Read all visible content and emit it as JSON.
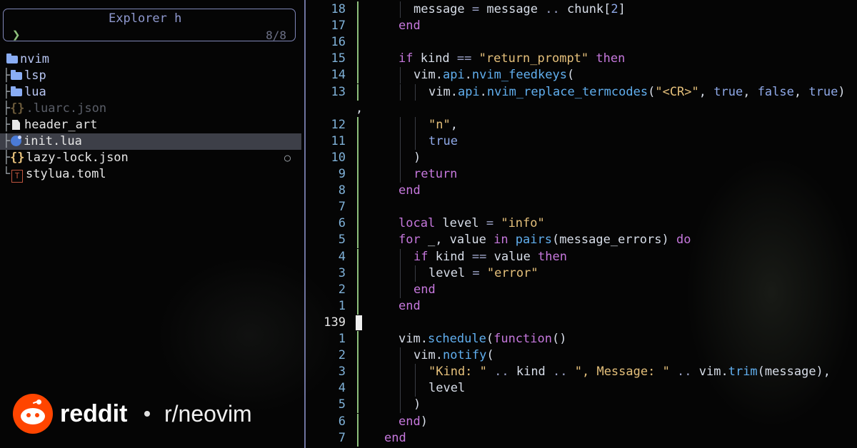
{
  "explorer": {
    "title": "Explorer  h",
    "prompt": "❯",
    "count": "8/8",
    "tree": [
      {
        "guide": "",
        "kind": "open-folder",
        "name": "nvim"
      },
      {
        "guide": "├",
        "kind": "folder",
        "name": "lsp"
      },
      {
        "guide": "├",
        "kind": "folder",
        "name": "lua"
      },
      {
        "guide": "├",
        "kind": "json-dim",
        "icon": "{}",
        "name": ".luarc.json"
      },
      {
        "guide": "├",
        "kind": "file",
        "name": "header_art"
      },
      {
        "guide": "├",
        "kind": "lua",
        "name": "init.lua",
        "selected": true
      },
      {
        "guide": "├",
        "kind": "json",
        "icon": "{}",
        "name": "lazy-lock.json",
        "marker": "○"
      },
      {
        "guide": "└",
        "kind": "toml",
        "icon": "T",
        "name": "stylua.toml"
      }
    ]
  },
  "editor": {
    "cursor_line": "139",
    "lines": [
      {
        "n": "18",
        "indent": 1,
        "tokens": [
          [
            "p",
            "message "
          ],
          [
            "o",
            "= "
          ],
          [
            "p",
            "message "
          ],
          [
            "o",
            ".. "
          ],
          [
            "p",
            "chunk["
          ],
          [
            "b",
            "2"
          ],
          [
            "p",
            "]"
          ]
        ]
      },
      {
        "n": "17",
        "indent": 0,
        "tokens": [
          [
            "k",
            "end"
          ]
        ]
      },
      {
        "n": "16",
        "indent": 0,
        "tokens": []
      },
      {
        "n": "15",
        "indent": 0,
        "tokens": [
          [
            "k",
            "if "
          ],
          [
            "p",
            "kind "
          ],
          [
            "o",
            "== "
          ],
          [
            "s",
            "\"return_prompt\" "
          ],
          [
            "k",
            "then"
          ]
        ]
      },
      {
        "n": "14",
        "indent": 1,
        "tokens": [
          [
            "p",
            "vim."
          ],
          [
            "f",
            "api"
          ],
          [
            "p",
            "."
          ],
          [
            "f",
            "nvim_feedkeys"
          ],
          [
            "p",
            "("
          ]
        ]
      },
      {
        "n": "13",
        "indent": 2,
        "tokens": [
          [
            "p",
            "vim."
          ],
          [
            "f",
            "api"
          ],
          [
            "p",
            "."
          ],
          [
            "f",
            "nvim_replace_termcodes"
          ],
          [
            "p",
            "("
          ],
          [
            "s",
            "\"<CR>\""
          ],
          [
            "p",
            ", "
          ],
          [
            "b",
            "true"
          ],
          [
            "p",
            ", "
          ],
          [
            "b",
            "false"
          ],
          [
            "p",
            ", "
          ],
          [
            "b",
            "true"
          ],
          [
            "p",
            ")"
          ]
        ]
      },
      {
        "n": "",
        "indent": -1,
        "tokens": [
          [
            "p",
            ","
          ]
        ]
      },
      {
        "n": "12",
        "indent": 2,
        "tokens": [
          [
            "s",
            "\"n\""
          ],
          [
            "p",
            ","
          ]
        ]
      },
      {
        "n": "11",
        "indent": 2,
        "tokens": [
          [
            "b",
            "true"
          ]
        ]
      },
      {
        "n": "10",
        "indent": 1,
        "tokens": [
          [
            "p",
            ")"
          ]
        ]
      },
      {
        "n": "9",
        "indent": 1,
        "tokens": [
          [
            "k",
            "return"
          ]
        ]
      },
      {
        "n": "8",
        "indent": 0,
        "tokens": [
          [
            "k",
            "end"
          ]
        ]
      },
      {
        "n": "7",
        "indent": 0,
        "tokens": []
      },
      {
        "n": "6",
        "indent": 0,
        "tokens": [
          [
            "k",
            "local "
          ],
          [
            "p",
            "level "
          ],
          [
            "o",
            "= "
          ],
          [
            "s",
            "\"info\""
          ]
        ]
      },
      {
        "n": "5",
        "indent": 0,
        "tokens": [
          [
            "k",
            "for "
          ],
          [
            "p",
            "_, value "
          ],
          [
            "k",
            "in "
          ],
          [
            "f",
            "pairs"
          ],
          [
            "p",
            "(message_errors) "
          ],
          [
            "k",
            "do"
          ]
        ]
      },
      {
        "n": "4",
        "indent": 1,
        "tokens": [
          [
            "k",
            "if "
          ],
          [
            "p",
            "kind "
          ],
          [
            "o",
            "== "
          ],
          [
            "p",
            "value "
          ],
          [
            "k",
            "then"
          ]
        ]
      },
      {
        "n": "3",
        "indent": 2,
        "tokens": [
          [
            "p",
            "level "
          ],
          [
            "o",
            "= "
          ],
          [
            "s",
            "\"error\""
          ]
        ]
      },
      {
        "n": "2",
        "indent": 1,
        "tokens": [
          [
            "k",
            "end"
          ]
        ]
      },
      {
        "n": "1",
        "indent": 0,
        "tokens": [
          [
            "k",
            "end"
          ]
        ]
      },
      {
        "n": "139",
        "indent": 0,
        "tokens": [],
        "current": true
      },
      {
        "n": "1",
        "indent": 0,
        "tokens": [
          [
            "p",
            "vim."
          ],
          [
            "f",
            "schedule"
          ],
          [
            "p",
            "("
          ],
          [
            "k",
            "function"
          ],
          [
            "p",
            "()"
          ]
        ]
      },
      {
        "n": "2",
        "indent": 1,
        "tokens": [
          [
            "p",
            "vim."
          ],
          [
            "f",
            "notify"
          ],
          [
            "p",
            "("
          ]
        ]
      },
      {
        "n": "3",
        "indent": 2,
        "tokens": [
          [
            "s",
            "\"Kind: \" "
          ],
          [
            "o",
            ".. "
          ],
          [
            "p",
            "kind "
          ],
          [
            "o",
            ".. "
          ],
          [
            "s",
            "\", Message: \" "
          ],
          [
            "o",
            ".. "
          ],
          [
            "p",
            "vim."
          ],
          [
            "f",
            "trim"
          ],
          [
            "p",
            "(message),"
          ]
        ]
      },
      {
        "n": "4",
        "indent": 2,
        "tokens": [
          [
            "p",
            "level"
          ]
        ]
      },
      {
        "n": "5",
        "indent": 1,
        "tokens": [
          [
            "p",
            ")"
          ]
        ]
      },
      {
        "n": "6",
        "indent": 0,
        "tokens": [
          [
            "k",
            "end"
          ],
          [
            "p",
            ")"
          ]
        ]
      },
      {
        "n": "7",
        "indent": -1,
        "tokens": [
          [
            "k",
            "end"
          ]
        ]
      }
    ]
  },
  "watermark": {
    "brand": "reddit",
    "separator": "•",
    "subreddit": "r/neovim"
  },
  "colors": {
    "background": "#050505",
    "accent_border": "#8087b8",
    "git_added": "#8ec07c",
    "reddit_orange": "#ff4500"
  }
}
